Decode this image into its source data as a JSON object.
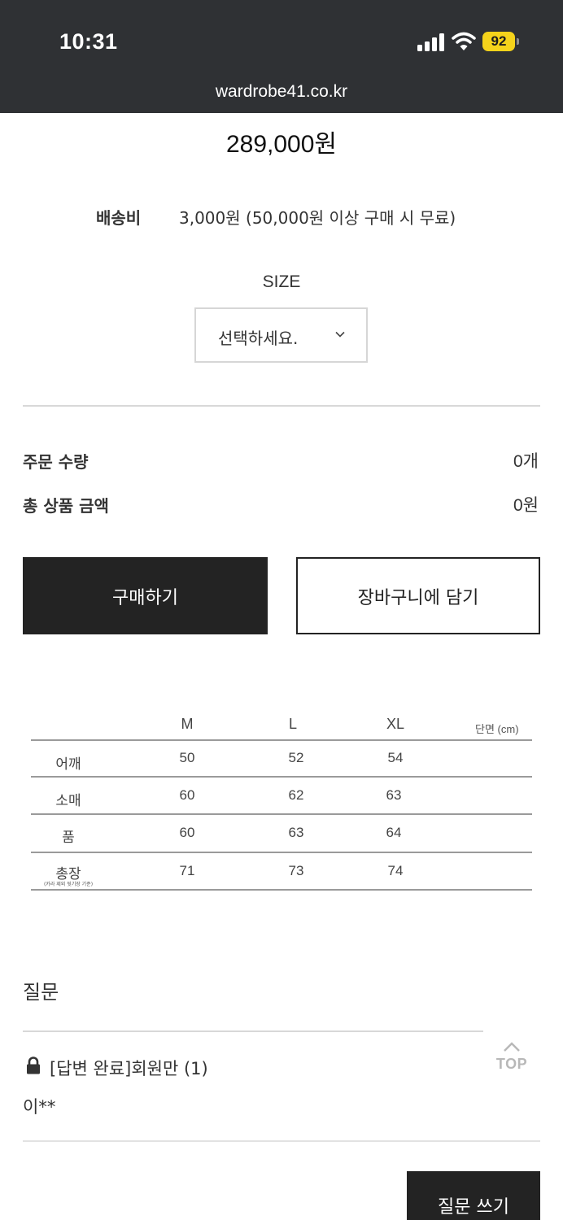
{
  "status_bar": {
    "time": "10:31",
    "battery": "92"
  },
  "browser": {
    "url": "wardrobe41.co.kr"
  },
  "product": {
    "price": "289,000원"
  },
  "shipping": {
    "label": "배송비",
    "value": "3,000원 (50,000원 이상 구매 시 무료)"
  },
  "size_option": {
    "label": "SIZE",
    "placeholder": "선택하세요."
  },
  "summary": {
    "quantity_label": "주문 수량",
    "quantity_value": "0개",
    "total_label": "총 상품 금액",
    "total_value": "0원"
  },
  "actions": {
    "buy": "구매하기",
    "cart": "장바구니에 담기"
  },
  "size_table": {
    "headers": [
      "M",
      "L",
      "XL"
    ],
    "unit": "단면 (cm)",
    "rows": [
      {
        "label": "어깨",
        "values": [
          "50",
          "52",
          "54"
        ]
      },
      {
        "label": "소매",
        "values": [
          "60",
          "62",
          "63"
        ]
      },
      {
        "label": "품",
        "values": [
          "60",
          "63",
          "64"
        ]
      },
      {
        "label": "총장",
        "values": [
          "71",
          "73",
          "74"
        ]
      }
    ],
    "note": "(카라 제외 뒷기장 기준)"
  },
  "qa": {
    "title": "질문",
    "top_label": "TOP",
    "items": [
      {
        "title": "[답변 완료]회원만 (1)",
        "author": "이**"
      }
    ],
    "write_button": "질문 쓰기"
  },
  "icons": {
    "lock": "lock-icon",
    "chevron": "chevron-down-icon",
    "top_arrow": "chevron-up-icon",
    "wifi": "wifi-icon",
    "signal": "signal-icon"
  }
}
